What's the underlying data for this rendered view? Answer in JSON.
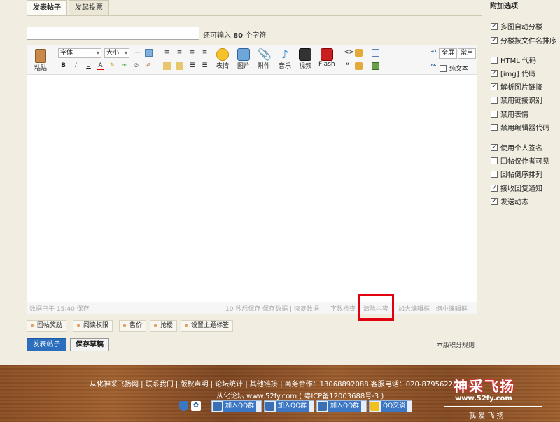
{
  "tabs": [
    "发表帖子",
    "发起投票"
  ],
  "subject": {
    "value": "",
    "hint_pre": "还可输入",
    "hint_num": "80",
    "hint_post": "个字符"
  },
  "toolbar": {
    "paste": "粘贴",
    "font": "字体",
    "size": "大小",
    "emoji": "表情",
    "image": "图片",
    "attach": "附件",
    "music": "音乐",
    "video": "视频",
    "flash": "Flash",
    "fullscreen": "全屏",
    "common": "常用",
    "plaintext": "纯文本",
    "bold": "B",
    "italic": "I",
    "underline": "U",
    "color": "A",
    "quote": "❝",
    "code": "<>"
  },
  "status": {
    "saved": "数据已于 15:40 保存",
    "autosave": "10 秒后保存 保存数据 | 恢复数据",
    "check": "字数检查",
    "clear": "清除内容",
    "enlarge": "加大编辑框 | 缩小编辑框"
  },
  "options": [
    "回帖奖励",
    "阅读权限",
    "售价",
    "抢楼",
    "设置主题标签"
  ],
  "post_button": "发表帖子",
  "draft_button": "保存草稿",
  "rules_link": "本版积分规则",
  "extra": {
    "title": "附加选项",
    "items": [
      {
        "label": "多图自动分楼",
        "checked": true
      },
      {
        "label": "分楼按文件名排序",
        "checked": true
      },
      {
        "label": "HTML 代码",
        "checked": false
      },
      {
        "label": "[img] 代码",
        "checked": true
      },
      {
        "label": "解析图片链接",
        "checked": true
      },
      {
        "label": "禁用链接识别",
        "checked": false
      },
      {
        "label": "禁用表情",
        "checked": false
      },
      {
        "label": "禁用编辑器代码",
        "checked": false
      },
      {
        "label": "使用个人签名",
        "checked": true
      },
      {
        "label": "回帖仅作者可见",
        "checked": false
      },
      {
        "label": "回帖倒序排列",
        "checked": false
      },
      {
        "label": "接收回复通知",
        "checked": true
      },
      {
        "label": "发送动态",
        "checked": true
      }
    ]
  },
  "footer": {
    "links": "从化神采飞扬网 | 联系我们 | 版权声明 | 论坛统计 | 其他链接 | 商务合作：13068892088 客服电话：020-87956228 | Archi",
    "icp": "从化论坛 www.52fy.com ( 粤ICP备12003688号-3 )",
    "qq": [
      "加入QQ群",
      "加入QQ群",
      "加入QQ群",
      "QQ交谈"
    ],
    "logo": "神采飞扬",
    "logo_url": "www.52fy.com",
    "logo_sub": "我 爱 飞 扬"
  },
  "colors": {
    "highlight": "#e0000f",
    "primary_button": "#2a6ebd",
    "footer_wood": "#8a4e22"
  }
}
